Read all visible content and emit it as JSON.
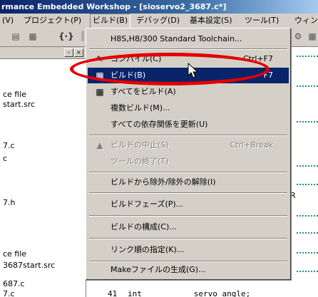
{
  "window": {
    "title": "rmance Embedded Workshop - [sioservo2_3687.c*]"
  },
  "menubar": {
    "items": [
      {
        "label": "(V)"
      },
      {
        "label": "プロジェクト(P)"
      },
      {
        "label": "ビルド(B)"
      },
      {
        "label": "デバッグ(D)"
      },
      {
        "label": "基本設定(S)"
      },
      {
        "label": "ツール(T)"
      },
      {
        "label": "ウィン"
      }
    ]
  },
  "left_panel": {
    "tree": [
      "ce file",
      "start.src",
      "7.c",
      "c",
      "7.h",
      "ce file",
      "3687start.src",
      "687.c",
      "7.c"
    ]
  },
  "editor": {
    "fragment": "R",
    "line_number": "41",
    "line_code": "int           servo_angle;"
  },
  "build_menu": {
    "toolchain": "H8S,H8/300 Standard Toolchain...",
    "compile": {
      "label": "コンパイル(C)",
      "shortcut": "Ctrl+F7"
    },
    "build": {
      "label": "ビルド(B)",
      "shortcut": "F7"
    },
    "build_all": {
      "label": "すべてをビルド(A)"
    },
    "multi_build": {
      "label": "複数ビルド(M)..."
    },
    "update_deps": {
      "label": "すべての依存関係を更新(U)"
    },
    "stop_build": {
      "label": "ビルドの中止(S)",
      "shortcut": "Ctrl+Break"
    },
    "end_tool": {
      "label": "ツールの終了(T)"
    },
    "exclude": {
      "label": "ビルドから除外/除外の解除(I)"
    },
    "phases": {
      "label": "ビルドフェーズ(P)..."
    },
    "config": {
      "label": "ビルドの構成(C)..."
    },
    "link_order": {
      "label": "リンク順の指定(K)..."
    },
    "makefile": {
      "label": "Makeファイルの生成(G)..."
    }
  },
  "colors": {
    "highlight": "#0a246a",
    "annotation": "#e40000"
  }
}
